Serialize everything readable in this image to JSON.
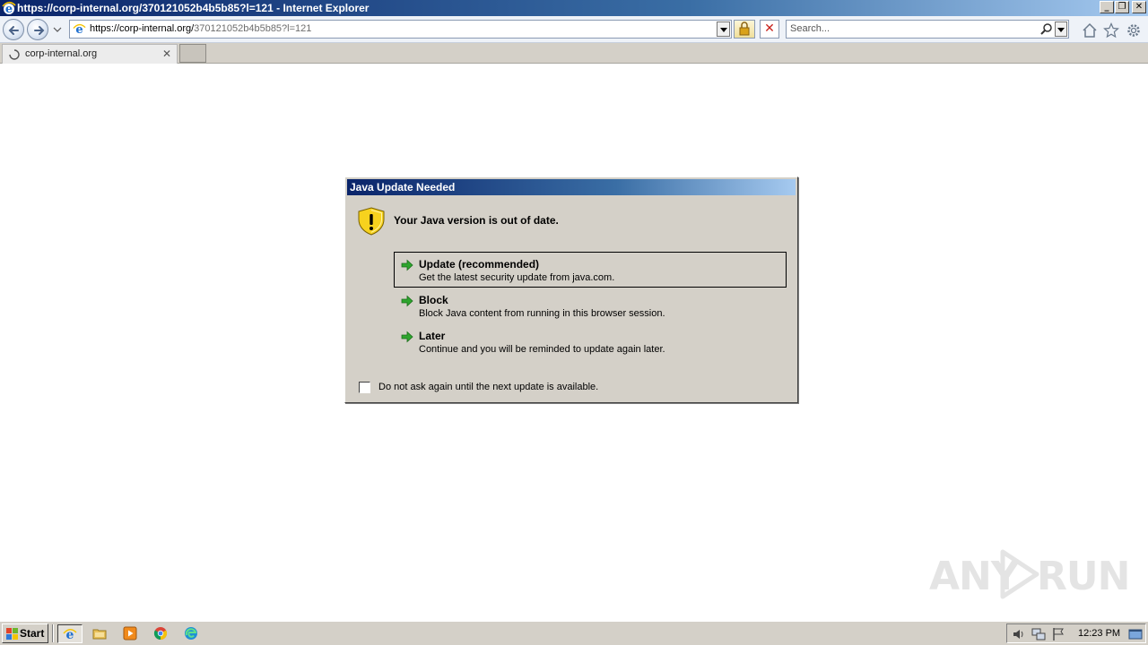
{
  "window": {
    "title": "https://corp-internal.org/370121052b4b5b85?l=121 - Internet Explorer",
    "controls": {
      "minimize": "_",
      "maximize": "❐",
      "close": "✕"
    }
  },
  "navbar": {
    "url_host": "https://corp-internal.org/",
    "url_path": "370121052b4b5b85?l=121",
    "search_placeholder": "Search..."
  },
  "tabs": [
    {
      "label": "corp-internal.org",
      "close": "✕"
    }
  ],
  "dialog": {
    "title": "Java Update Needed",
    "headline": "Your Java version is out of date.",
    "options": [
      {
        "title": "Update (recommended)",
        "description": "Get the latest security update from java.com.",
        "selected": true
      },
      {
        "title": "Block",
        "description": "Block Java content from running in this browser session.",
        "selected": false
      },
      {
        "title": "Later",
        "description": "Continue and you will be reminded to update again later.",
        "selected": false
      }
    ],
    "checkbox_label": "Do not ask again until the next update is available.",
    "checkbox_checked": false
  },
  "watermark": {
    "left": "ANY",
    "right": "RUN"
  },
  "taskbar": {
    "start_label": "Start",
    "apps": [
      "ie-icon",
      "folder-icon",
      "media-player-icon",
      "chrome-icon",
      "edge-icon"
    ],
    "clock": "12:23 PM"
  },
  "colors": {
    "titlebar_start": "#0a246a",
    "titlebar_end": "#a6caf0",
    "dialog_bg": "#d4d0c8",
    "arrow_green": "#2ea52e",
    "warn_yellow": "#f7d21e"
  }
}
